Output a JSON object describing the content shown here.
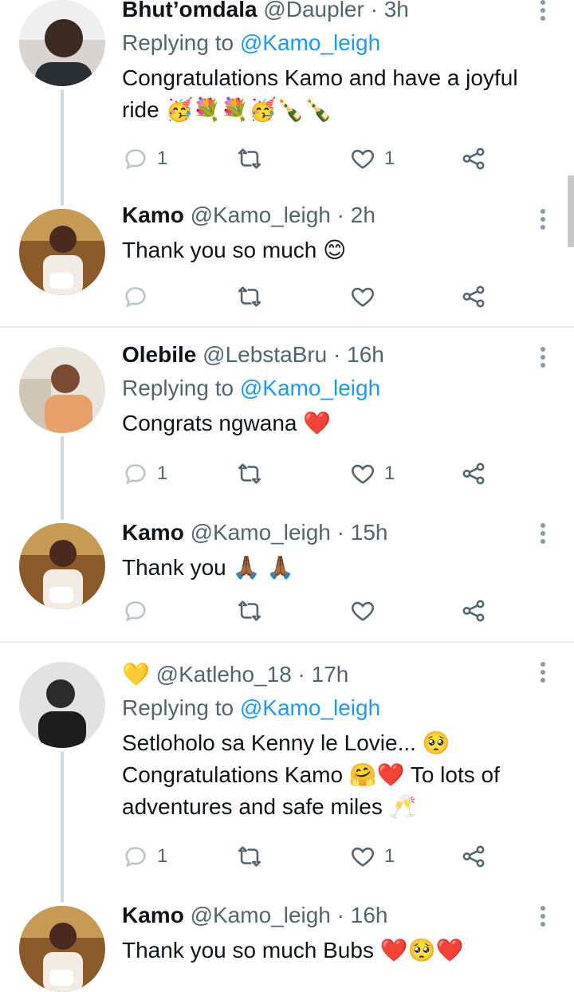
{
  "tweets": [
    {
      "name": "Bhut’omdala",
      "handle": "@Daupler",
      "time": "3h",
      "replying_prefix": "Replying to ",
      "replying_to": "@Kamo_leigh",
      "text_lines": [
        "Congratulations Kamo and have a joyful",
        "ride 🥳💐💐🥳🍾🍾"
      ],
      "replies": "1",
      "likes": "1"
    },
    {
      "name": "Kamo",
      "handle": "@Kamo_leigh",
      "time": "2h",
      "text_lines": [
        "Thank you so much 😊"
      ],
      "replies": "",
      "likes": ""
    },
    {
      "name": "Olebile",
      "handle": "@LebstaBru",
      "time": "16h",
      "replying_prefix": "Replying to ",
      "replying_to": "@Kamo_leigh",
      "text_lines": [
        "Congrats ngwana ❤️"
      ],
      "replies": "1",
      "likes": "1"
    },
    {
      "name": "Kamo",
      "handle": "@Kamo_leigh",
      "time": "15h",
      "text_lines": [
        "Thank you 🙏🏾 🙏🏾"
      ],
      "replies": "",
      "likes": ""
    },
    {
      "name": "💛",
      "handle": "@Katleho_18",
      "time": "17h",
      "replying_prefix": "Replying to ",
      "replying_to": "@Kamo_leigh",
      "text_lines": [
        "Setloholo sa Kenny le Lovie... 🥺",
        "Congratulations Kamo 🤗❤️ To lots of",
        "adventures and safe miles 🥂"
      ],
      "replies": "1",
      "likes": "1"
    },
    {
      "name": "Kamo",
      "handle": "@Kamo_leigh",
      "time": "16h",
      "text_lines": [
        "Thank you so much Bubs ❤️🥺❤️"
      ],
      "replies": "",
      "likes": ""
    }
  ],
  "separator": "·",
  "colors": {
    "accent": "#1d9bf0",
    "secondary": "#536471",
    "text": "#0f1419",
    "divider": "#e6ecf0"
  },
  "icons": {
    "reply": "reply-icon",
    "retweet": "retweet-icon",
    "like": "like-icon",
    "share": "share-icon",
    "more": "more-icon"
  }
}
